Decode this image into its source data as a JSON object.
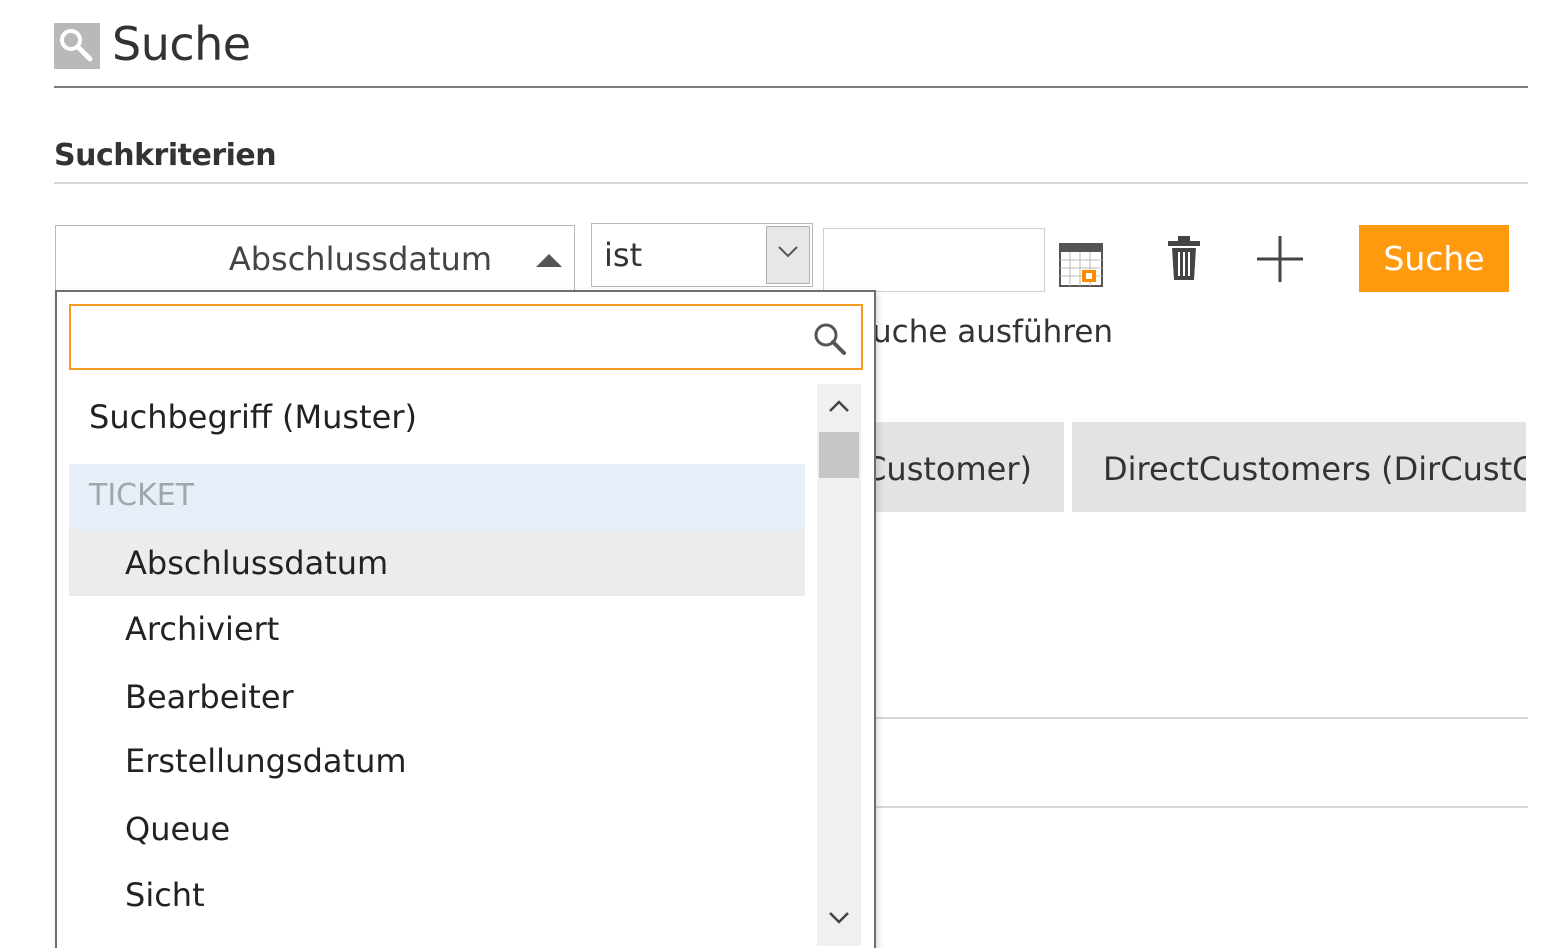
{
  "header": {
    "title": "Suche",
    "icon": "search-icon"
  },
  "section": {
    "title": "Suchkriterien"
  },
  "criteria": {
    "field_value": "Abschlussdatum",
    "operator_value": "ist",
    "value_input": "",
    "search_button_label": "Suche",
    "accent_color": "#ff9a0f"
  },
  "run_search_text": "uche ausführen",
  "columns": [
    "Customer)",
    "DirectCustomers (DirCustC"
  ],
  "dropdown": {
    "search_value": "",
    "items": [
      {
        "label": "Suchbegriff (Muster)",
        "kind": "top"
      },
      {
        "label": "TICKET",
        "kind": "group"
      },
      {
        "label": "Abschlussdatum",
        "kind": "child",
        "selected": true
      },
      {
        "label": "Archiviert",
        "kind": "child"
      },
      {
        "label": "Bearbeiter",
        "kind": "child"
      },
      {
        "label": "Erstellungsdatum",
        "kind": "child"
      },
      {
        "label": "Queue",
        "kind": "child"
      },
      {
        "label": "Sicht",
        "kind": "child"
      }
    ]
  }
}
